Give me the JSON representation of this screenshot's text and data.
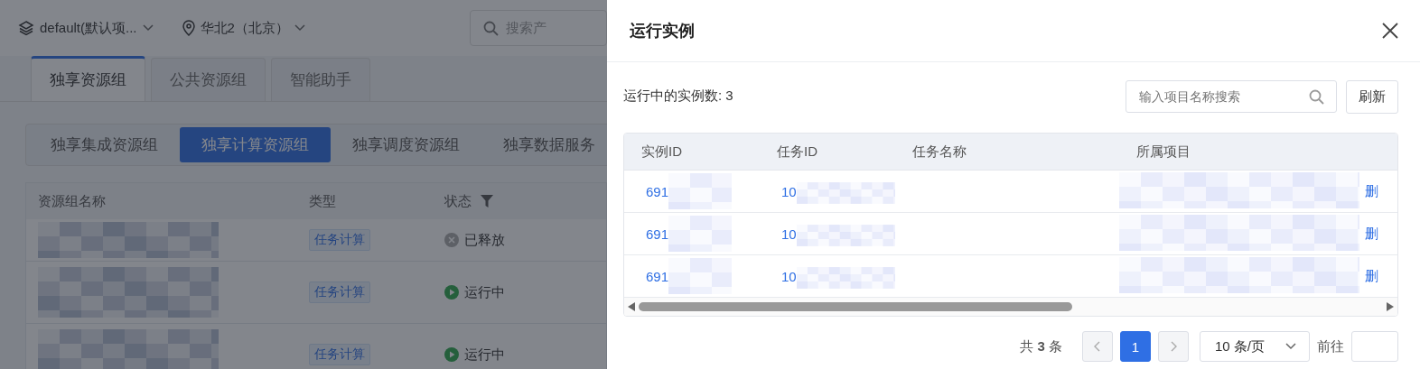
{
  "topbar": {
    "project": "default(默认项...",
    "region": "华北2（北京）",
    "search_placeholder": "搜索产"
  },
  "tabs": [
    {
      "label": "独享资源组",
      "selected": true
    },
    {
      "label": "公共资源组",
      "selected": false
    },
    {
      "label": "智能助手",
      "selected": false
    }
  ],
  "subtabs": [
    {
      "label": "独享集成资源组",
      "selected": false
    },
    {
      "label": "独享计算资源组",
      "selected": true
    },
    {
      "label": "独享调度资源组",
      "selected": false
    },
    {
      "label": "独享数据服务",
      "selected": false
    }
  ],
  "resource_table": {
    "columns": [
      "资源组名称",
      "类型",
      "状态"
    ],
    "rows": [
      {
        "type": "任务计算",
        "status": {
          "kind": "released",
          "label": "已释放"
        }
      },
      {
        "type": "任务计算",
        "status": {
          "kind": "running",
          "label": "运行中"
        }
      },
      {
        "type": "任务计算",
        "status": {
          "kind": "running",
          "label": "运行中"
        }
      }
    ]
  },
  "drawer": {
    "title": "运行实例",
    "count_label": "运行中的实例数: 3",
    "search_placeholder": "输入项目名称搜索",
    "refresh": "刷新",
    "columns": [
      "实例ID",
      "任务ID",
      "任务名称",
      "所属项目"
    ],
    "rows": [
      {
        "instance_id": "691",
        "task_id": "10",
        "action": "删"
      },
      {
        "instance_id": "691",
        "task_id": "10",
        "action": "删"
      },
      {
        "instance_id": "691",
        "task_id": "10",
        "action": "删"
      }
    ],
    "pagination": {
      "total": "共 **3** 条",
      "pages": [
        {
          "label": "1",
          "selected": true
        }
      ],
      "page_size": "10 条/页",
      "goto_label": "前往"
    }
  }
}
